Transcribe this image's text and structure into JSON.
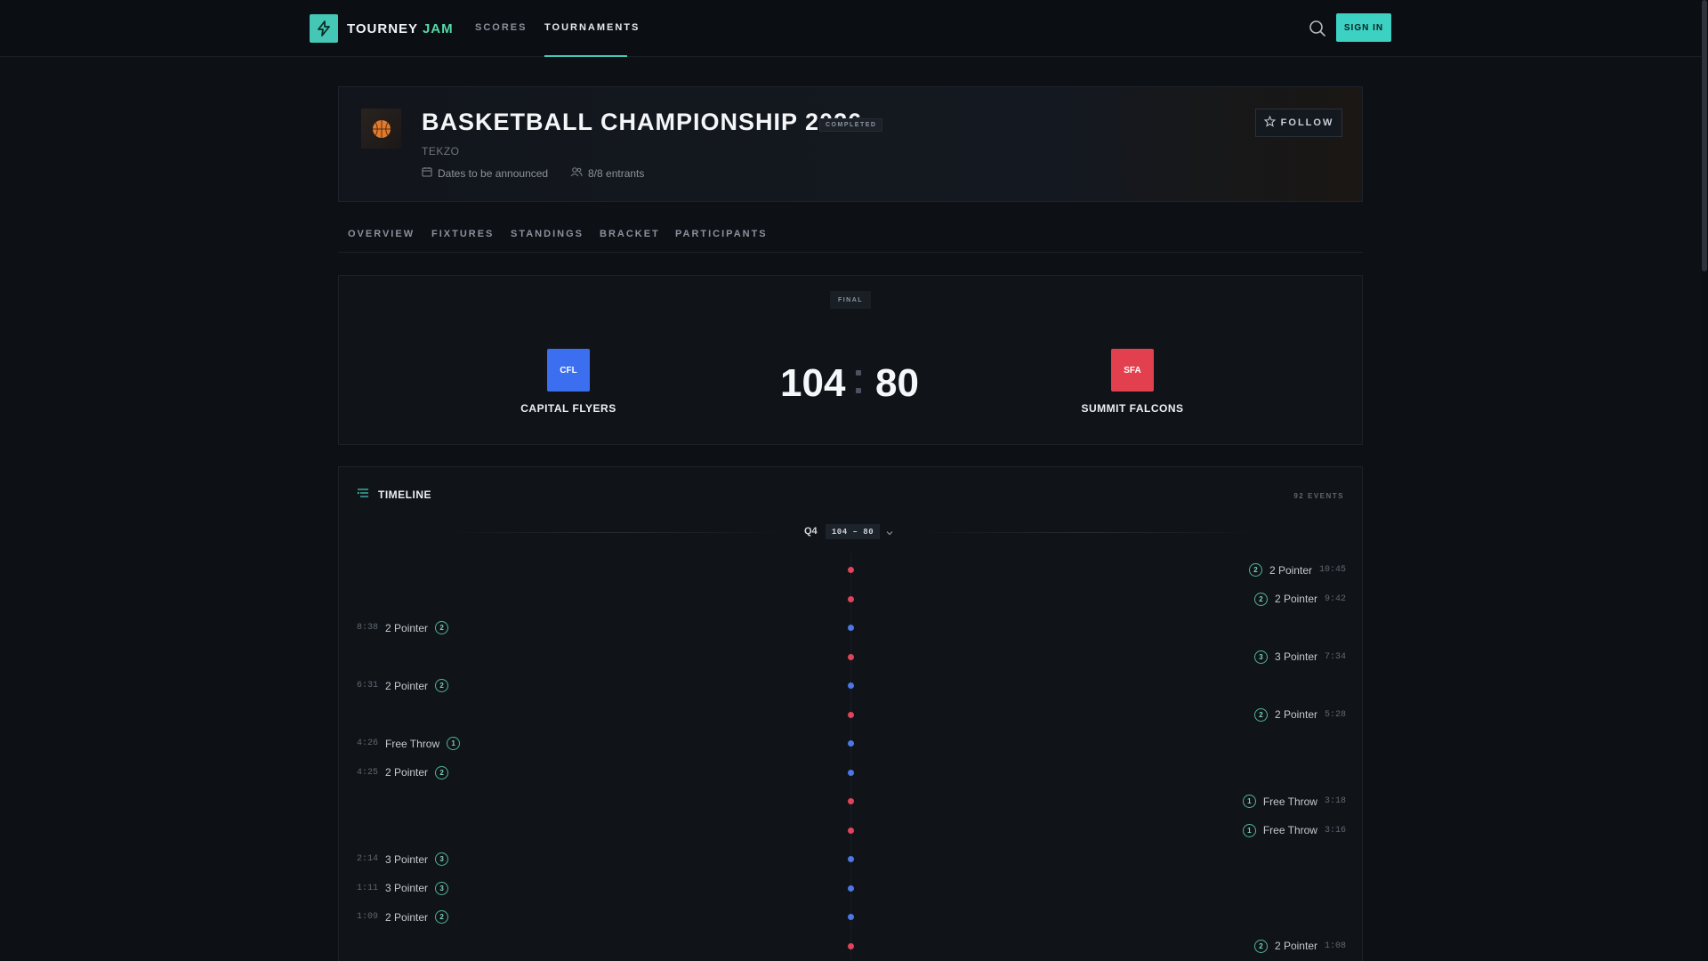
{
  "nav": {
    "logo_word1": "TOURNEY",
    "logo_word2": "JAM",
    "links": [
      "SCORES",
      "TOURNAMENTS"
    ],
    "active": "TOURNAMENTS",
    "signin_label": "SIGN IN",
    "accent_color": "#45c7b6"
  },
  "tournament": {
    "title": "BASKETBALL CHAMPIONSHIP 2026",
    "status": "COMPLETED",
    "organizer": "TEKZO",
    "dates": "Dates to be announced",
    "entrants": "8/8 entrants",
    "follow_label": "FOLLOW",
    "sport_icon": "basketball-icon"
  },
  "tabs": [
    "OVERVIEW",
    "FIXTURES",
    "STANDINGS",
    "BRACKET",
    "PARTICIPANTS"
  ],
  "match": {
    "status": "FINAL",
    "home": {
      "abbr": "CFL",
      "name": "CAPITAL FLYERS",
      "score": "104",
      "color": "#3b6ff0"
    },
    "away": {
      "abbr": "SFA",
      "name": "SUMMIT FALCONS",
      "score": "80",
      "color": "#e2404f"
    }
  },
  "timeline": {
    "title": "TIMELINE",
    "count": "92 EVENTS",
    "period": "Q4",
    "period_score": "104 – 80",
    "events": [
      {
        "side": "right",
        "team": "away",
        "label": "2 Pointer",
        "points": "2",
        "time": "10:45"
      },
      {
        "side": "right",
        "team": "away",
        "label": "2 Pointer",
        "points": "2",
        "time": "9:42"
      },
      {
        "side": "left",
        "team": "home",
        "label": "2 Pointer",
        "points": "2",
        "time": "8:38"
      },
      {
        "side": "right",
        "team": "away",
        "label": "3 Pointer",
        "points": "3",
        "time": "7:34"
      },
      {
        "side": "left",
        "team": "home",
        "label": "2 Pointer",
        "points": "2",
        "time": "6:31"
      },
      {
        "side": "right",
        "team": "away",
        "label": "2 Pointer",
        "points": "2",
        "time": "5:28"
      },
      {
        "side": "left",
        "team": "home",
        "label": "Free Throw",
        "points": "1",
        "time": "4:26"
      },
      {
        "side": "left",
        "team": "home",
        "label": "2 Pointer",
        "points": "2",
        "time": "4:25"
      },
      {
        "side": "right",
        "team": "away",
        "label": "Free Throw",
        "points": "1",
        "time": "3:18"
      },
      {
        "side": "right",
        "team": "away",
        "label": "Free Throw",
        "points": "1",
        "time": "3:16"
      },
      {
        "side": "left",
        "team": "home",
        "label": "3 Pointer",
        "points": "3",
        "time": "2:14"
      },
      {
        "side": "left",
        "team": "home",
        "label": "3 Pointer",
        "points": "3",
        "time": "1:11"
      },
      {
        "side": "left",
        "team": "home",
        "label": "2 Pointer",
        "points": "2",
        "time": "1:09"
      },
      {
        "side": "right",
        "team": "away",
        "label": "2 Pointer",
        "points": "2",
        "time": "1:08"
      }
    ]
  }
}
